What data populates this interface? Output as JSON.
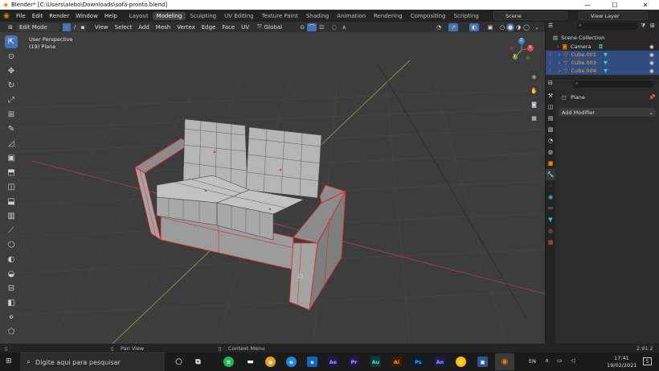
{
  "window": {
    "title": "Blender* [C:\\Users\\alebo\\Downloads\\sofa-pronto.blend]",
    "minimize": "—",
    "maximize": "☐",
    "close": "✕"
  },
  "menu": [
    "File",
    "Edit",
    "Render",
    "Window",
    "Help"
  ],
  "workspaces": [
    "Layout",
    "Modeling",
    "Sculpting",
    "UV Editing",
    "Texture Paint",
    "Shading",
    "Animation",
    "Rendering",
    "Compositing",
    "Scripting"
  ],
  "active_workspace": "Modeling",
  "scene": {
    "label": "Scene"
  },
  "view_layer": {
    "label": "View Layer"
  },
  "header": {
    "mode": "Edit Mode",
    "menus": [
      "View",
      "Select",
      "Add",
      "Mesh",
      "Vertex",
      "Edge",
      "Face",
      "UV"
    ],
    "orientation": "Global"
  },
  "viewport": {
    "perspective": "User Perspective",
    "object": "(19) Plane"
  },
  "gizmo": {
    "x": "X",
    "y": "Y",
    "z": "Z"
  },
  "outliner": {
    "collection": "Scene Collection",
    "items": [
      {
        "name": "Camera",
        "selected": false
      },
      {
        "name": "Cube.001",
        "selected": true
      },
      {
        "name": "Cube.003",
        "selected": true
      },
      {
        "name": "Cube.004",
        "selected": true
      }
    ]
  },
  "properties": {
    "object": "Plane",
    "add_modifier": "Add Modifier"
  },
  "status_bar": {
    "pan": "Pan View",
    "context": "Context Menu",
    "version": "2.91.2"
  },
  "taskbar": {
    "search_placeholder": "Digite aqui para pesquisar",
    "apps": [
      "Ae",
      "Pr",
      "Au",
      "Ai",
      "Ps",
      "An"
    ],
    "lang": "EN",
    "time": "17:41",
    "date": "19/02/2021",
    "notifications": "5"
  },
  "colors": {
    "accent": "#4772b3",
    "selected_row": "#334d80",
    "orange": "#e87d0d",
    "wire": "#e02020"
  }
}
